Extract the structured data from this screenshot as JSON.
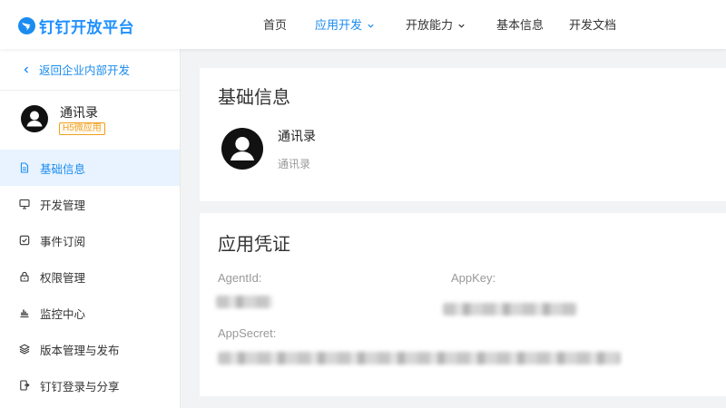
{
  "colors": {
    "accent": "#1a8cf0",
    "brand": "#1e90ff",
    "badge": "#f0a020",
    "active_bg": "#e8f3ff",
    "page_bg": "#f2f3f5",
    "text": "#333333",
    "muted": "#999999"
  },
  "header": {
    "brand_icon": "dingtalk-logo-icon",
    "brand": "钉钉开放平台",
    "nav": [
      {
        "label": "首页",
        "has_dropdown": false,
        "active": false
      },
      {
        "label": "应用开发",
        "has_dropdown": true,
        "active": true
      },
      {
        "label": "开放能力",
        "has_dropdown": true,
        "active": false
      },
      {
        "label": "基本信息",
        "has_dropdown": false,
        "active": false
      },
      {
        "label": "开发文档",
        "has_dropdown": false,
        "active": false
      }
    ]
  },
  "sidebar": {
    "back_icon": "chevron-left-icon",
    "back_link": "返回企业内部开发",
    "app": {
      "avatar_icon": "user-avatar-icon",
      "name": "通讯录",
      "badge": "H5微应用"
    },
    "menu": [
      {
        "label": "基础信息",
        "icon": "document-icon",
        "active": true
      },
      {
        "label": "开发管理",
        "icon": "monitor-icon",
        "active": false
      },
      {
        "label": "事件订阅",
        "icon": "check-square-icon",
        "active": false
      },
      {
        "label": "权限管理",
        "icon": "lock-icon",
        "active": false
      },
      {
        "label": "监控中心",
        "icon": "bar-chart-icon",
        "active": false
      },
      {
        "label": "版本管理与发布",
        "icon": "layers-icon",
        "active": false
      },
      {
        "label": "钉钉登录与分享",
        "icon": "mobile-share-icon",
        "active": false
      }
    ]
  },
  "main": {
    "basic_info": {
      "title": "基础信息",
      "avatar_icon": "user-avatar-icon",
      "app_name": "通讯录",
      "app_description": "通讯录"
    },
    "credentials": {
      "title": "应用凭证",
      "agent_id_label": "AgentId:",
      "app_key_label": "AppKey:",
      "app_secret_label": "AppSecret:",
      "values_redacted": true
    }
  }
}
